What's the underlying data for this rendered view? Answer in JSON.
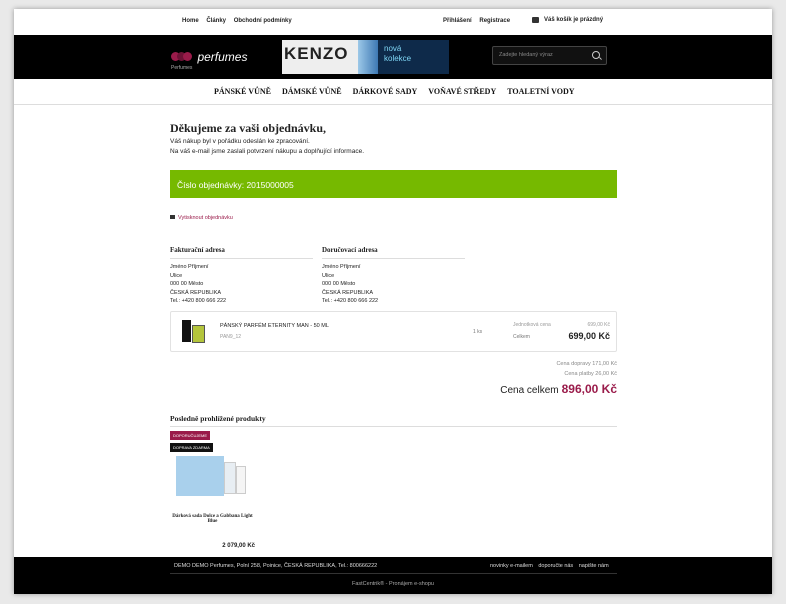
{
  "topbar": {
    "links": [
      "Home",
      "Články",
      "Obchodní podmínky"
    ],
    "login": "Přihlášení",
    "register": "Registrace",
    "cart": "Váš košík je prázdný"
  },
  "header": {
    "logo_name": "perfumes",
    "logo_sub": "Perfumes",
    "banner_brand": "KENZO",
    "banner_text_1": "nová",
    "banner_text_2": "kolekce",
    "search_placeholder": "Zadejte hledaný výraz"
  },
  "nav": [
    "PÁNSKÉ VŮNĚ",
    "DÁMSKÉ VŮNĚ",
    "DÁRKOVÉ SADY",
    "VOŇAVÉ STŘEDY",
    "TOALETNÍ VODY"
  ],
  "confirmation": {
    "title": "Děkujeme za vaši objednávku,",
    "line1": "Váš nákup byl v pořádku odeslán ke zpracování.",
    "line2": "Na váš e-mail jsme zaslali potvrzení nákupu a doplňující informace.",
    "order_number": "Číslo objednávky: 2015000005",
    "print": "Vytisknout objednávku"
  },
  "billing": {
    "heading": "Fakturační adresa",
    "lines": [
      "Jméno Příjmení",
      "Ulice",
      "000 00 Město",
      "ČESKÁ REPUBLIKA",
      "Tel.: +420 800 666 222"
    ]
  },
  "shipping": {
    "heading": "Doručovací adresa",
    "lines": [
      "Jméno Příjmení",
      "Ulice",
      "000 00 Město",
      "ČESKÁ REPUBLIKA",
      "Tel.: +420 800 666 222"
    ]
  },
  "item": {
    "name": "PÁNSKÝ PARFÉM ETERNITY MAN - 50 ML",
    "code": "PAN9_12",
    "qty": "1 ks",
    "unit_label": "Jednotková cena",
    "unit_price": "699,00 Kč",
    "total_label": "Celkem",
    "total_price": "699,00 Kč"
  },
  "summary": {
    "shipping": "Cena dopravy 171,00 Kč",
    "payment": "Cena platby 26,00 Kč",
    "total_label": "Cena celkem",
    "total_value": "896,00 Kč"
  },
  "recent": {
    "heading": "Posledně prohlížené produkty",
    "badge_recommended": "DOPORUČUJEME",
    "badge_free_shipping": "DOPRAVA ZDARMA",
    "product_name": "Dárková sada Dolce a Gabbana Light Blue",
    "product_price": "2 079,00 Kč"
  },
  "footer": {
    "address": "DEMO DEMO Perfumes, Polní 258, Poinice, ČESKÁ REPUBLIKA, Tel.: 800666222",
    "links": [
      "novinky e-mailem",
      "doporučte nás",
      "napište nám"
    ],
    "credit": "FastCentrik® - Pronájem e-shopu"
  },
  "colors": {
    "accent": "#9a1b4a",
    "order_bar": "#76b900",
    "header_bg": "#000000"
  }
}
